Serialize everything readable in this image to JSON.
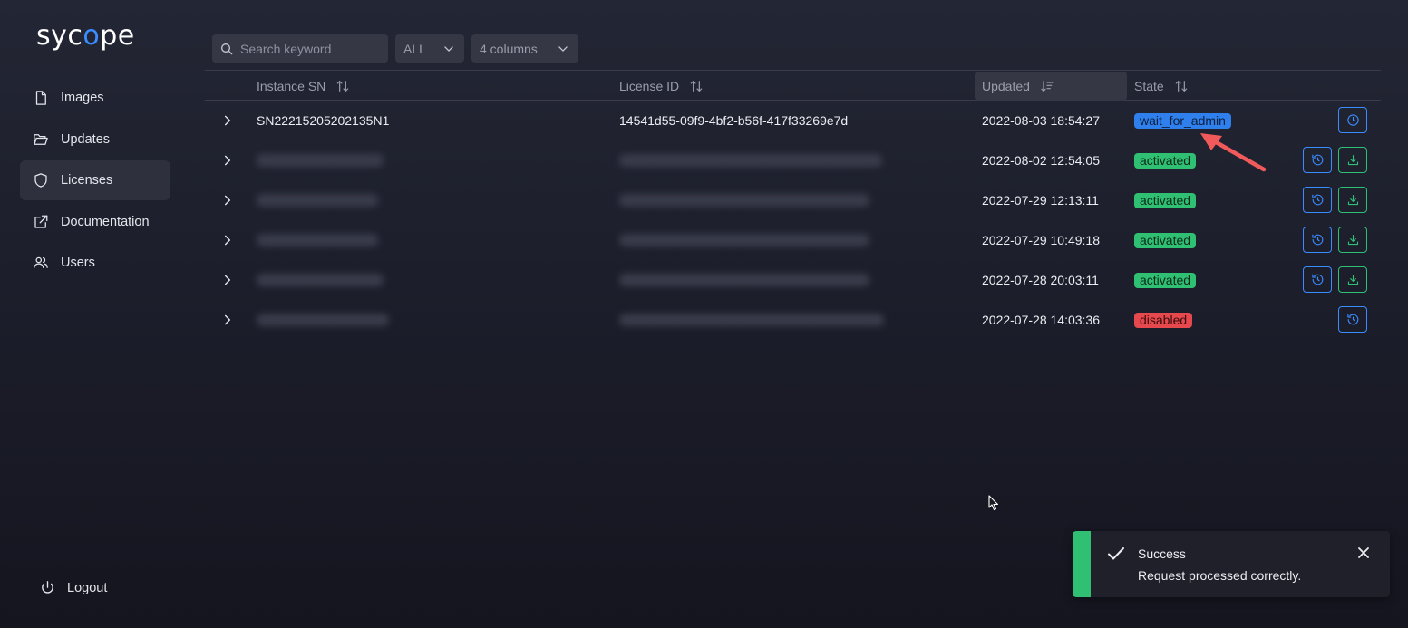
{
  "brand": {
    "logo_pre": "syc",
    "logo_accent": "o",
    "logo_post": "pe"
  },
  "sidebar": {
    "items": [
      {
        "label": "Images",
        "icon": "file-icon"
      },
      {
        "label": "Updates",
        "icon": "folder-open-icon"
      },
      {
        "label": "Licenses",
        "icon": "shield-icon",
        "active": true
      },
      {
        "label": "Documentation",
        "icon": "external-link-icon"
      },
      {
        "label": "Users",
        "icon": "users-icon"
      }
    ],
    "logout_label": "Logout"
  },
  "toolbar": {
    "search_placeholder": "Search keyword",
    "filter_value": "ALL",
    "columns_value": "4 columns"
  },
  "table": {
    "columns": [
      "Instance SN",
      "License ID",
      "Updated",
      "State"
    ],
    "sorted_column": "Updated",
    "rows": [
      {
        "instance_sn": "SN22215205202135N1",
        "license_id": "14541d55-09f9-4bf2-b56f-417f33269e7d",
        "updated": "2022-08-03 18:54:27",
        "state": "wait_for_admin",
        "state_color": "#2f80ed",
        "actions": [
          "clock-icon"
        ]
      },
      {
        "instance_sn": "",
        "license_id": "",
        "updated": "2022-08-02 12:54:05",
        "state": "activated",
        "state_color": "#2fc073",
        "actions": [
          "history-icon",
          "download-icon"
        ]
      },
      {
        "instance_sn": "",
        "license_id": "",
        "updated": "2022-07-29 12:13:11",
        "state": "activated",
        "state_color": "#2fc073",
        "actions": [
          "history-icon",
          "download-icon"
        ]
      },
      {
        "instance_sn": "",
        "license_id": "",
        "updated": "2022-07-29 10:49:18",
        "state": "activated",
        "state_color": "#2fc073",
        "actions": [
          "history-icon",
          "download-icon"
        ]
      },
      {
        "instance_sn": "",
        "license_id": "",
        "updated": "2022-07-28 20:03:11",
        "state": "activated",
        "state_color": "#2fc073",
        "actions": [
          "history-icon",
          "download-icon"
        ]
      },
      {
        "instance_sn": "",
        "license_id": "",
        "updated": "2022-07-28 14:03:36",
        "state": "disabled",
        "state_color": "#e5484d",
        "actions": [
          "history-icon"
        ]
      }
    ]
  },
  "toast": {
    "title": "Success",
    "message": "Request processed correctly.",
    "color": "#2fc073"
  },
  "colors": {
    "accent_blue": "#3b8cff",
    "success_green": "#2fc073",
    "danger_red": "#e5484d",
    "annotation_arrow": "#f05a5a"
  }
}
